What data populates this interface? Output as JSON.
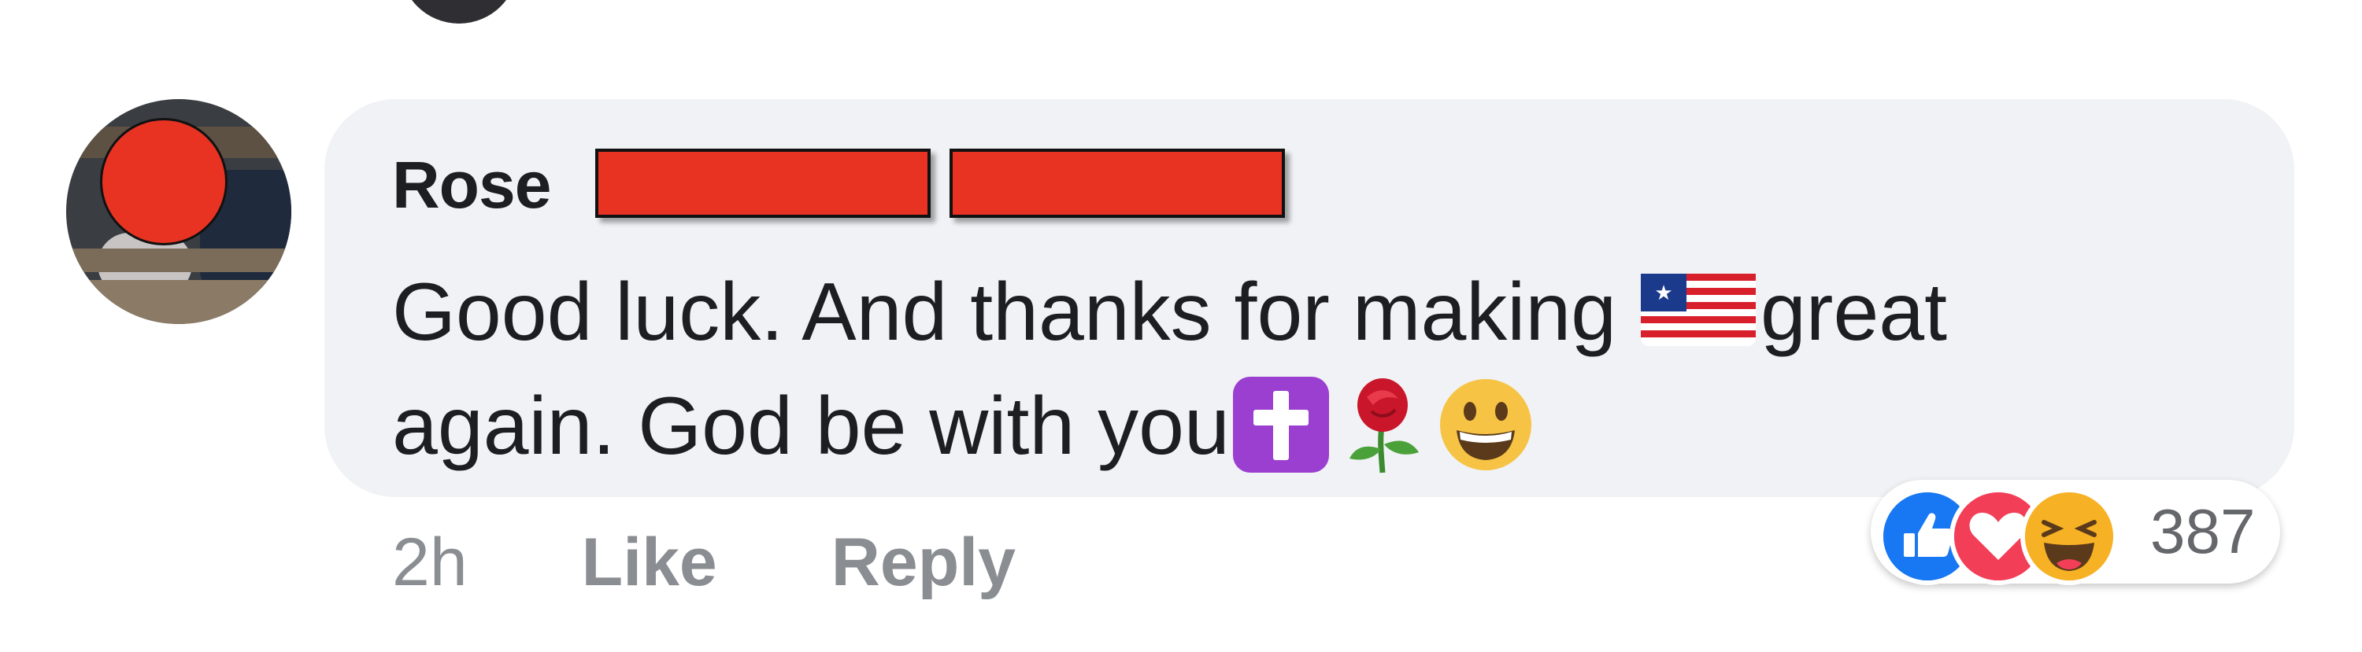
{
  "comment": {
    "author": "Rose",
    "message_line1": "Good luck. And thanks for making ",
    "message_line1_tail": "great",
    "message_line2": "again. God be with you",
    "emojis": [
      "flag-icon",
      "cross-icon",
      "rose-icon",
      "grinning-face-icon"
    ]
  },
  "actions": {
    "timestamp": "2h",
    "like_label": "Like",
    "reply_label": "Reply"
  },
  "reactions": {
    "types": [
      "like-icon",
      "love-icon",
      "haha-icon"
    ],
    "count": "387"
  },
  "colors": {
    "bubble": "#f0f2f5",
    "redaction": "#e83323",
    "like_blue": "#1877f2",
    "love_red": "#f33e58",
    "haha_yellow": "#f7b125"
  }
}
